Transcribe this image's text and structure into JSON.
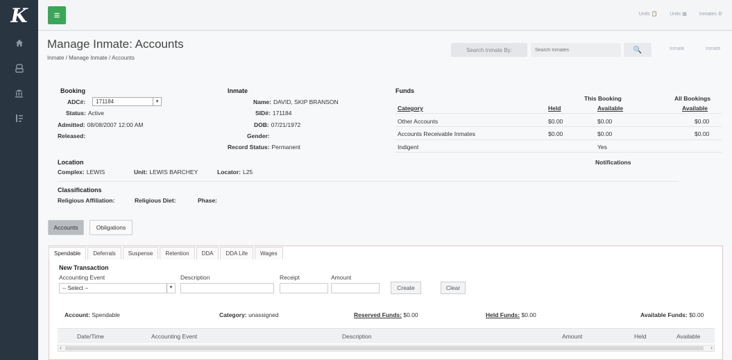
{
  "app": {
    "logo": "K"
  },
  "header": {
    "title": "Manage Inmate: Accounts",
    "breadcrumb": "Inmate / Manage Inmate / Accounts",
    "search_label": "Search Inmate By:",
    "search_placeholder": "Search Inmates",
    "search_icon": "🔍",
    "link_1": "Inmate",
    "link_2": "Inmate"
  },
  "topbar": {
    "right_1": "Units 📋",
    "right_2": "Units ▦",
    "right_3": "Inmates ⚙"
  },
  "booking": {
    "section": "Booking",
    "adc_label": "ADC#:",
    "adc_value": "171184",
    "status_label": "Status:",
    "status_value": "Active",
    "admitted_label": "Admitted:",
    "admitted_value": "08/08/2007  12:00 AM",
    "released_label": "Released:"
  },
  "inmate": {
    "section": "Inmate",
    "name_label": "Name:",
    "name_value": "DAVID, SKIP BRANSON",
    "sid_label": "SID#:",
    "sid_value": "171184",
    "dob_label": "DOB:",
    "dob_value": "07/21/1972",
    "gender_label": "Gender:",
    "record_label": "Record Status:",
    "record_value": "Permanent"
  },
  "funds": {
    "section": "Funds",
    "this_booking": "This Booking",
    "all_bookings": "All Bookings",
    "col_category": "Category",
    "col_held": "Held",
    "col_available": "Available",
    "col_all_available": "Available",
    "rows": [
      {
        "category": "Other Accounts",
        "held": "$0.00",
        "available": "$0.00",
        "all": "$0.00"
      },
      {
        "category": "Accounts Receivable Inmates",
        "held": "$0.00",
        "available": "$0.00",
        "all": "$0.00"
      },
      {
        "category": "Indigent",
        "held": "",
        "available": "Yes",
        "all": ""
      }
    ],
    "notifications": "Notifications"
  },
  "location": {
    "section": "Location",
    "complex_label": "Complex:",
    "complex_value": "LEWIS",
    "unit_label": "Unit:",
    "unit_value": "LEWIS BARCHEY",
    "locator_label": "Locator:",
    "locator_value": "L25"
  },
  "classifications": {
    "section": "Classifications",
    "religious_affiliation": "Religious Affiliation:",
    "religious_diet": "Religious Diet:",
    "phase": "Phase:"
  },
  "tabs": {
    "accounts": "Accounts",
    "obligations": "Obligations"
  },
  "subtabs": [
    "Spendable",
    "Deferrals",
    "Suspense",
    "Retention",
    "DDA",
    "DDA Life",
    "Wages"
  ],
  "new_transaction": {
    "title": "New Transaction",
    "event_label": "Accounting Event",
    "event_value": "-- Select --",
    "description_label": "Description",
    "receipt_label": "Receipt",
    "amount_label": "Amount",
    "create": "Create",
    "clear": "Clear"
  },
  "account_bar": {
    "account_label": "Account:",
    "account_value": "Spendable",
    "category_label": "Category:",
    "category_value": "unassigned",
    "reserved_label": "Reserved Funds:",
    "reserved_value": "$0.00",
    "held_label": "Held Funds:",
    "held_value": "$0.00",
    "available_label": "Available Funds:",
    "available_value": "$0.00"
  },
  "table": {
    "columns": [
      "Date/Time",
      "Accounting Event",
      "Description",
      "Amount",
      "Held",
      "Available"
    ]
  }
}
